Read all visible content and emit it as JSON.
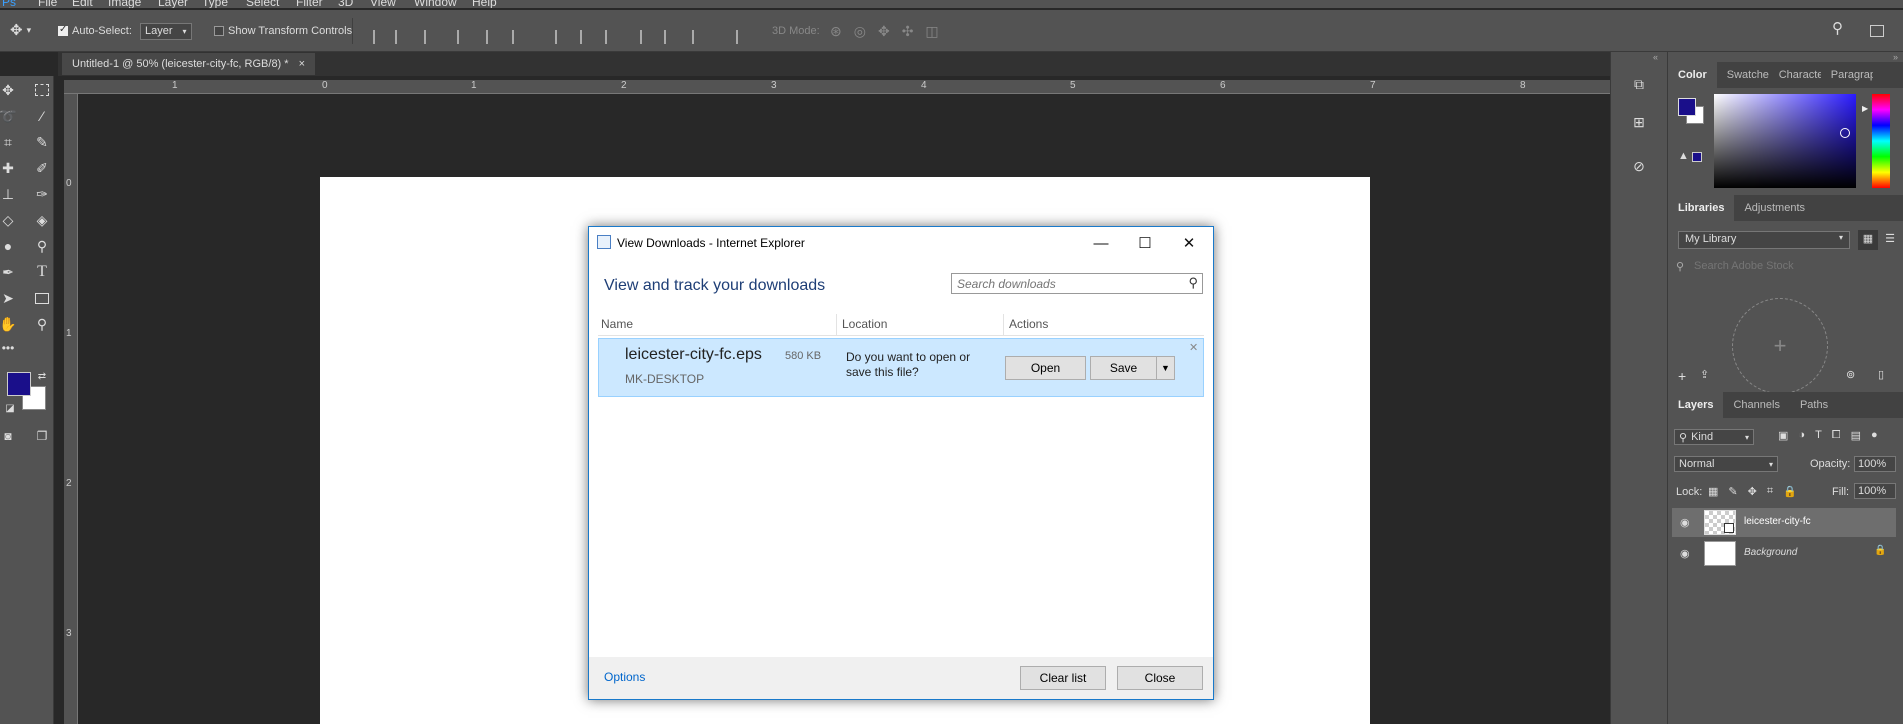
{
  "menubar": {
    "items": [
      "File",
      "Edit",
      "Image",
      "Layer",
      "Type",
      "Select",
      "Filter",
      "3D",
      "View",
      "Window",
      "Help"
    ]
  },
  "options_bar": {
    "auto_select_label": "Auto-Select:",
    "auto_select_checked": true,
    "auto_select_value": "Layer",
    "show_transform_label": "Show Transform Controls",
    "show_transform_checked": false,
    "mode_3d_label": "3D Mode:"
  },
  "document_tab": {
    "title": "Untitled-1 @ 50% (leicester-city-fc, RGB/8) *",
    "close": "×"
  },
  "ruler": {
    "top_numbers": [
      "1",
      "0",
      "1",
      "2",
      "3",
      "4",
      "5",
      "6",
      "7",
      "8"
    ],
    "left_numbers": [
      "0",
      "1",
      "2",
      "3"
    ]
  },
  "tools": [
    "move-tool",
    "marquee-tool",
    "lasso-tool",
    "magic-wand-tool",
    "crop-tool",
    "eyedropper-tool",
    "healing-brush-tool",
    "brush-tool",
    "clone-stamp-tool",
    "history-brush-tool",
    "eraser-tool",
    "paint-bucket-tool",
    "blur-tool",
    "dodge-tool",
    "pen-tool",
    "type-tool",
    "path-selection-tool",
    "rectangle-tool",
    "hand-tool",
    "zoom-tool",
    "more-tools"
  ],
  "colors": {
    "foreground": "#1a0f8a",
    "background": "#ffffff",
    "dialog_accent": "#1979ca",
    "row_highlight": "#cce8ff"
  },
  "panels": {
    "color_tabs": [
      "Color",
      "Swatches",
      "Characters",
      "Paragraph"
    ],
    "library_tabs": [
      "Libraries",
      "Adjustments"
    ],
    "library_name": "My Library",
    "stock_search_placeholder": "Search Adobe Stock",
    "layers_tabs": [
      "Layers",
      "Channels",
      "Paths"
    ],
    "filter_kind": "Kind",
    "blend_mode": "Normal",
    "opacity_label": "Opacity:",
    "opacity_value": "100%",
    "lock_label": "Lock:",
    "fill_label": "Fill:",
    "fill_value": "100%",
    "layers": [
      {
        "name": "leicester-city-fc",
        "selected": true
      },
      {
        "name": "Background",
        "locked": true
      }
    ]
  },
  "dialog": {
    "title": "View Downloads - Internet Explorer",
    "heading": "View and track your downloads",
    "search_placeholder": "Search downloads",
    "columns": {
      "name": "Name",
      "location": "Location",
      "actions": "Actions"
    },
    "download": {
      "file_name": "leicester-city-fc.eps",
      "size": "580 KB",
      "source": "MK-DESKTOP",
      "prompt": "Do you want to open or save this file?",
      "open_label": "Open",
      "save_label": "Save"
    },
    "options_link": "Options",
    "clear_list_label": "Clear list",
    "close_label": "Close"
  }
}
